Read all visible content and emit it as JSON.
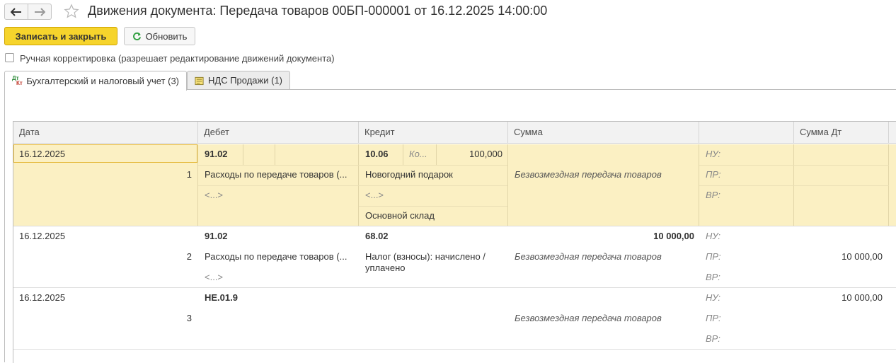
{
  "window": {
    "title": "Движения документа: Передача товаров 00БП-000001 от 16.12.2025 14:00:00"
  },
  "toolbar": {
    "save_close_label": "Записать и закрыть",
    "refresh_label": "Обновить"
  },
  "manual_correction": {
    "label": "Ручная корректировка (разрешает редактирование движений документа)",
    "checked": false
  },
  "tabs": [
    {
      "label": "Бухгалтерский и налоговый учет (3)",
      "icon": "dt-kt-icon",
      "active": true
    },
    {
      "label": "НДС Продажи (1)",
      "icon": "register-icon",
      "active": false
    }
  ],
  "table": {
    "headers": {
      "date": "Дата",
      "debit": "Дебет",
      "credit": "Кредит",
      "sum": "Сумма",
      "blank": "",
      "sum_dt": "Сумма Дт"
    },
    "rows": [
      {
        "date": "16.12.2025",
        "num": "1",
        "debit_account": "91.02",
        "debit_sub1": "Расходы по передаче товаров (...",
        "debit_sub2": "<...>",
        "credit_account": "10.06",
        "credit_qty_label": "Ко...",
        "credit_qty": "100,000",
        "credit_sub1": "Новогодний подарок",
        "credit_sub2": "<...>",
        "credit_sub3": "Основной склад",
        "sum": "",
        "content": "Безвозмездная передача товаров",
        "nu_label": "НУ:",
        "pr_label": "ПР:",
        "vr_label": "ВР:",
        "nu": "",
        "pr": "",
        "vr": ""
      },
      {
        "date": "16.12.2025",
        "num": "2",
        "debit_account": "91.02",
        "debit_sub1": "Расходы по передаче товаров (...",
        "debit_sub2": "<...>",
        "credit_account": "68.02",
        "credit_sub1": "Налог (взносы): начислено /",
        "credit_sub1_cont": "уплачено",
        "sum": "10 000,00",
        "content": "Безвозмездная передача товаров",
        "nu_label": "НУ:",
        "pr_label": "ПР:",
        "vr_label": "ВР:",
        "nu": "",
        "pr": "10 000,00",
        "vr": ""
      },
      {
        "date": "16.12.2025",
        "num": "3",
        "debit_account": "НЕ.01.9",
        "sum": "",
        "content": "Безвозмездная передача товаров",
        "nu_label": "НУ:",
        "pr_label": "ПР:",
        "vr_label": "ВР:",
        "nu": "10 000,00",
        "pr": "",
        "vr": ""
      }
    ]
  },
  "colors": {
    "accent_button": "#f6d42c",
    "selected_row": "#fbf0c3",
    "refresh_icon": "#2e9e3e"
  }
}
